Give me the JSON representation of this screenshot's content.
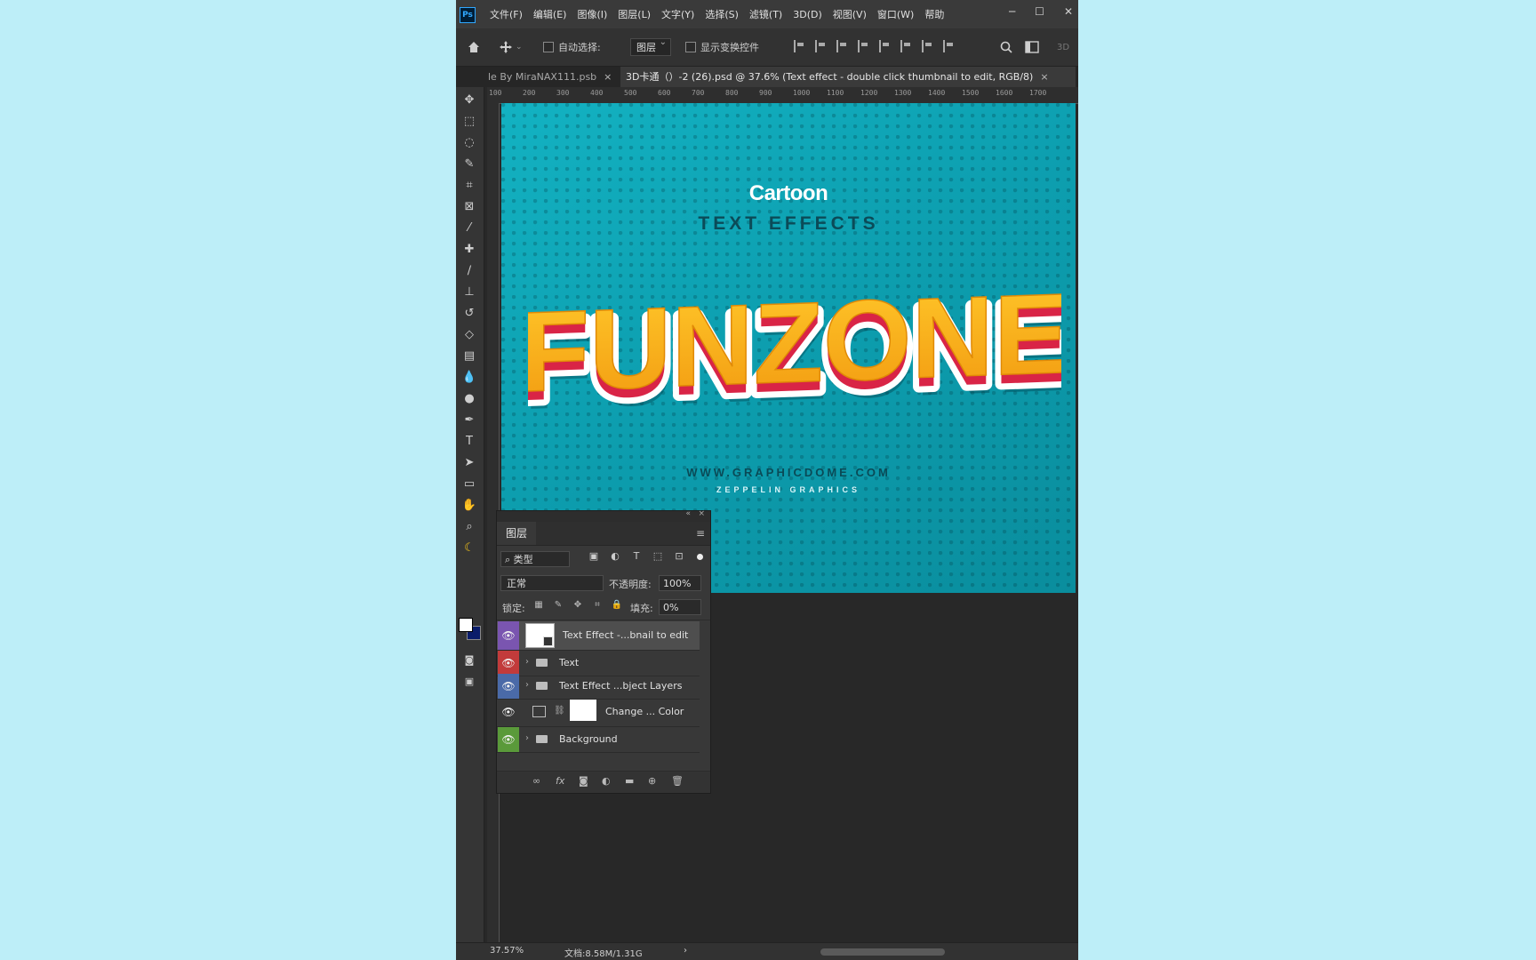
{
  "colors": {
    "page_bg": "#bdeef8",
    "canvas_teal": "#0d9fb0",
    "funzone_fill": "#f7b11d",
    "funzone_red": "#d92446",
    "eye_purple": "#7a55b0",
    "eye_red": "#c23b3b",
    "eye_blue": "#4a6aa8",
    "eye_green": "#5a9a3a"
  },
  "menubar": {
    "items": [
      "文件(F)",
      "编辑(E)",
      "图像(I)",
      "图层(L)",
      "文字(Y)",
      "选择(S)",
      "滤镜(T)",
      "3D(D)",
      "视图(V)",
      "窗口(W)",
      "帮助"
    ],
    "window_controls": [
      "─",
      "☐",
      "✕"
    ]
  },
  "options": {
    "auto_select_label": "自动选择:",
    "auto_select_value": "图层",
    "show_transform_label": "显示变换控件",
    "mode_3d": "3D"
  },
  "tabs": [
    {
      "label": "le By MiraNAX111.psb",
      "close": "×"
    },
    {
      "label": "3D卡通（）-2 (26).psd @ 37.6% (Text effect - double click thumbnail to edit, RGB/8)",
      "close": "×"
    }
  ],
  "ruler_ticks": [
    "100",
    "200",
    "300",
    "400",
    "500",
    "600",
    "700",
    "800",
    "900",
    "1000",
    "1100",
    "1200",
    "1300",
    "1400",
    "1500",
    "1600",
    "1700"
  ],
  "canvas_text": {
    "line1": "Cartoon",
    "line2": "TEXT EFFECTS",
    "headline": "FUNZONE",
    "url": "WWW.GRAPHICDOME.COM",
    "brand": "ZEPPELIN GRAPHICS"
  },
  "layers_panel": {
    "title": "图层",
    "filter_label": "类型",
    "blend_mode": "正常",
    "opacity_label": "不透明度:",
    "opacity_value": "100%",
    "lock_label": "锁定:",
    "fill_label": "填充:",
    "fill_value": "0%",
    "layers": [
      {
        "name": "Text Effect -...bnail to edit"
      },
      {
        "name": "Text"
      },
      {
        "name": "Text Effect ...bject Layers"
      },
      {
        "name": "Change ... Color"
      },
      {
        "name": "Background"
      }
    ]
  },
  "status": {
    "zoom": "37.57%",
    "doc_size": "文档:8.58M/1.31G"
  }
}
